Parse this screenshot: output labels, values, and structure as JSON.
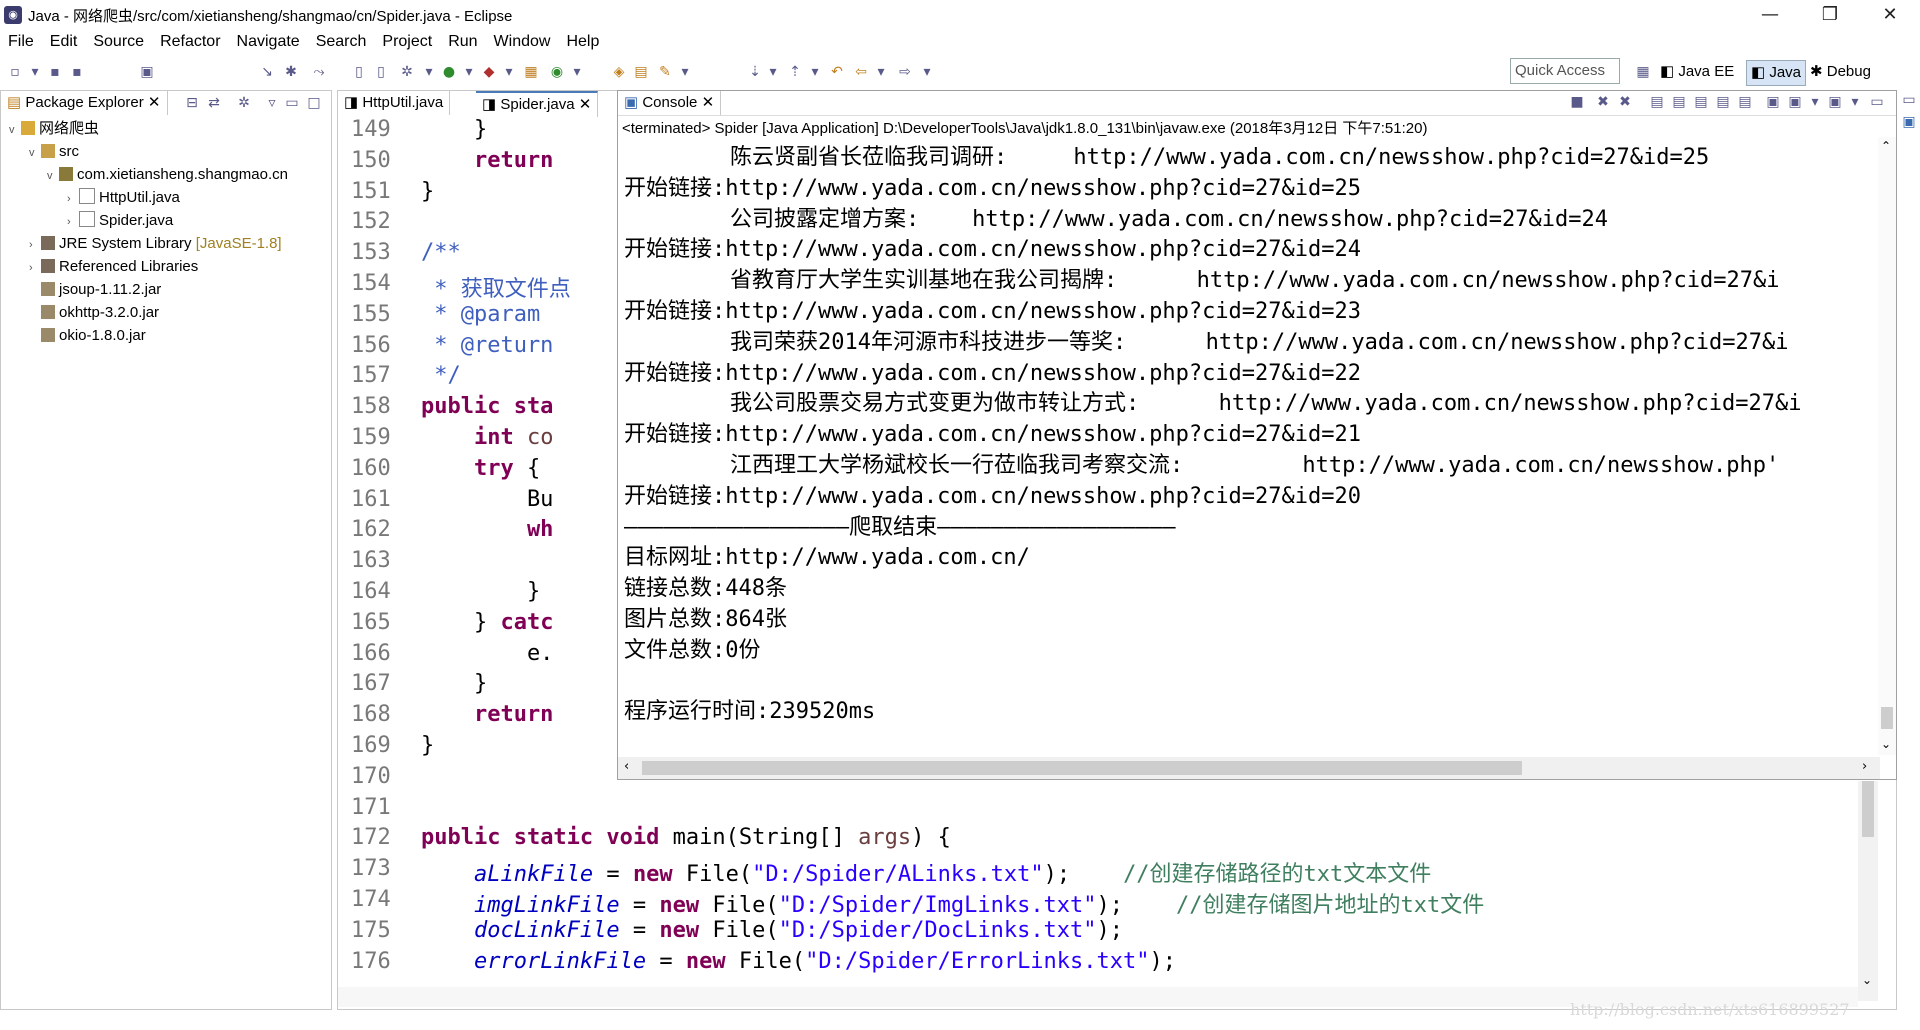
{
  "window": {
    "title": "Java - 网络爬虫/src/com/xietiansheng/shangmao/cn/Spider.java - Eclipse",
    "minimize": "—",
    "restore": "❐",
    "close": "✕"
  },
  "menu": [
    "File",
    "Edit",
    "Source",
    "Refactor",
    "Navigate",
    "Search",
    "Project",
    "Run",
    "Window",
    "Help"
  ],
  "toolbar": {
    "quick_access": "Quick Access",
    "perspectives": [
      "Java EE",
      "Java",
      "Debug"
    ]
  },
  "package_explorer": {
    "tab_label": "Package Explorer",
    "tree": [
      {
        "label": "网络爬虫",
        "depth": 0,
        "expanded": true,
        "icon": "project-icon"
      },
      {
        "label": "src",
        "depth": 1,
        "expanded": true,
        "icon": "source-folder-icon"
      },
      {
        "label": "com.xietiansheng.shangmao.cn",
        "depth": 2,
        "expanded": true,
        "icon": "package-icon"
      },
      {
        "label": "HttpUtil.java",
        "depth": 3,
        "expanded": false,
        "icon": "java-file-icon"
      },
      {
        "label": "Spider.java",
        "depth": 3,
        "expanded": false,
        "icon": "java-file-icon"
      },
      {
        "label": "JRE System Library",
        "suffix": "[JavaSE-1.8]",
        "depth": 1,
        "expanded": false,
        "icon": "library-icon"
      },
      {
        "label": "Referenced Libraries",
        "depth": 1,
        "expanded": false,
        "icon": "library-icon"
      },
      {
        "label": "jsoup-1.11.2.jar",
        "depth": 1,
        "icon": "jar-icon"
      },
      {
        "label": "okhttp-3.2.0.jar",
        "depth": 1,
        "icon": "jar-icon"
      },
      {
        "label": "okio-1.8.0.jar",
        "depth": 1,
        "icon": "jar-icon"
      }
    ]
  },
  "editor": {
    "tabs": [
      "HttpUtil.java",
      "Spider.java"
    ],
    "line_numbers": [
      "149",
      "150",
      "151",
      "152",
      "153",
      "154",
      "155",
      "156",
      "157",
      "158",
      "159",
      "160",
      "161",
      "162",
      "163",
      "164",
      "165",
      "166",
      "167",
      "168",
      "169",
      "170",
      "171",
      "172",
      "173",
      "174",
      "175",
      "176"
    ],
    "lines": [
      [
        {
          "t": "        }",
          "c": ""
        }
      ],
      [
        {
          "t": "        return",
          "c": "kw"
        }
      ],
      [
        {
          "t": "    }",
          "c": ""
        }
      ],
      [
        {
          "t": "",
          "c": ""
        }
      ],
      [
        {
          "t": "    /**",
          "c": "jd"
        }
      ],
      [
        {
          "t": "     * 获取文件点",
          "c": "jd"
        }
      ],
      [
        {
          "t": "     * @param",
          "c": "jd"
        }
      ],
      [
        {
          "t": "     * @return",
          "c": "jd"
        }
      ],
      [
        {
          "t": "     */",
          "c": "jd"
        }
      ],
      [
        {
          "t": "    public sta",
          "c": "kw"
        }
      ],
      [
        {
          "t": "        ",
          "c": ""
        },
        {
          "t": "int",
          "c": "kw"
        },
        {
          "t": " co",
          "c": "prm"
        }
      ],
      [
        {
          "t": "        ",
          "c": ""
        },
        {
          "t": "try",
          "c": "kw"
        },
        {
          "t": " {",
          "c": ""
        }
      ],
      [
        {
          "t": "            Bu",
          "c": ""
        }
      ],
      [
        {
          "t": "            wh",
          "c": "kw"
        }
      ],
      [
        {
          "t": "",
          "c": ""
        }
      ],
      [
        {
          "t": "            }",
          "c": ""
        }
      ],
      [
        {
          "t": "        } ",
          "c": ""
        },
        {
          "t": "catc",
          "c": "kw"
        }
      ],
      [
        {
          "t": "            e.",
          "c": ""
        }
      ],
      [
        {
          "t": "        }",
          "c": ""
        }
      ],
      [
        {
          "t": "        return",
          "c": "kw"
        }
      ],
      [
        {
          "t": "    }",
          "c": ""
        }
      ],
      [
        {
          "t": "",
          "c": ""
        }
      ],
      [
        {
          "t": "",
          "c": ""
        }
      ],
      [
        {
          "t": "    ",
          "c": ""
        },
        {
          "t": "public static void",
          "c": "kw"
        },
        {
          "t": " main(String[] ",
          "c": ""
        },
        {
          "t": "args",
          "c": "prm"
        },
        {
          "t": ") {",
          "c": ""
        }
      ],
      [
        {
          "t": "        ",
          "c": ""
        },
        {
          "t": "aLinkFile",
          "c": "fld"
        },
        {
          "t": " = ",
          "c": ""
        },
        {
          "t": "new",
          "c": "kw"
        },
        {
          "t": " File(",
          "c": ""
        },
        {
          "t": "\"D:/Spider/ALinks.txt\"",
          "c": "str"
        },
        {
          "t": ");    ",
          "c": ""
        },
        {
          "t": "//创建存储路径的txt文本文件",
          "c": "cm"
        }
      ],
      [
        {
          "t": "        ",
          "c": ""
        },
        {
          "t": "imgLinkFile",
          "c": "fld"
        },
        {
          "t": " = ",
          "c": ""
        },
        {
          "t": "new",
          "c": "kw"
        },
        {
          "t": " File(",
          "c": ""
        },
        {
          "t": "\"D:/Spider/ImgLinks.txt\"",
          "c": "str"
        },
        {
          "t": ");    ",
          "c": ""
        },
        {
          "t": "//创建存储图片地址的txt文件",
          "c": "cm"
        }
      ],
      [
        {
          "t": "        ",
          "c": ""
        },
        {
          "t": "docLinkFile",
          "c": "fld"
        },
        {
          "t": " = ",
          "c": ""
        },
        {
          "t": "new",
          "c": "kw"
        },
        {
          "t": " File(",
          "c": ""
        },
        {
          "t": "\"D:/Spider/DocLinks.txt\"",
          "c": "str"
        },
        {
          "t": ");",
          "c": ""
        }
      ],
      [
        {
          "t": "        ",
          "c": ""
        },
        {
          "t": "errorLinkFile",
          "c": "fld"
        },
        {
          "t": " = ",
          "c": ""
        },
        {
          "t": "new",
          "c": "kw"
        },
        {
          "t": " File(",
          "c": ""
        },
        {
          "t": "\"D:/Spider/ErrorLinks.txt\"",
          "c": "str"
        },
        {
          "t": ");",
          "c": ""
        }
      ]
    ]
  },
  "console": {
    "tab_label": "Console",
    "terminated": "<terminated> Spider [Java Application] D:\\DeveloperTools\\Java\\jdk1.8.0_131\\bin\\javaw.exe (2018年3月12日 下午7:51:20)",
    "lines": [
      "        陈云贤副省长莅临我司调研:     http://www.yada.com.cn/newsshow.php?cid=27&id=25",
      "开始链接:http://www.yada.com.cn/newsshow.php?cid=27&id=25",
      "        公司披露定增方案:    http://www.yada.com.cn/newsshow.php?cid=27&id=24",
      "开始链接:http://www.yada.com.cn/newsshow.php?cid=27&id=24",
      "        省教育厅大学生实训基地在我公司揭牌:      http://www.yada.com.cn/newsshow.php?cid=27&i",
      "开始链接:http://www.yada.com.cn/newsshow.php?cid=27&id=23",
      "        我司荣获2014年河源市科技进步一等奖:      http://www.yada.com.cn/newsshow.php?cid=27&i",
      "开始链接:http://www.yada.com.cn/newsshow.php?cid=27&id=22",
      "        我公司股票交易方式变更为做市转让方式:      http://www.yada.com.cn/newsshow.php?cid=27&i",
      "开始链接:http://www.yada.com.cn/newsshow.php?cid=27&id=21",
      "        江西理工大学杨斌校长一行莅临我司考察交流:         http://www.yada.com.cn/newsshow.php'",
      "开始链接:http://www.yada.com.cn/newsshow.php?cid=27&id=20",
      "—————————————————爬取结束——————————————————",
      "目标网址:http://www.yada.com.cn/",
      "链接总数:448条",
      "图片总数:864张",
      "文件总数:0份",
      "",
      "程序运行时间:239520ms"
    ]
  },
  "watermark": "http://blog.csdn.net/xts616899527"
}
